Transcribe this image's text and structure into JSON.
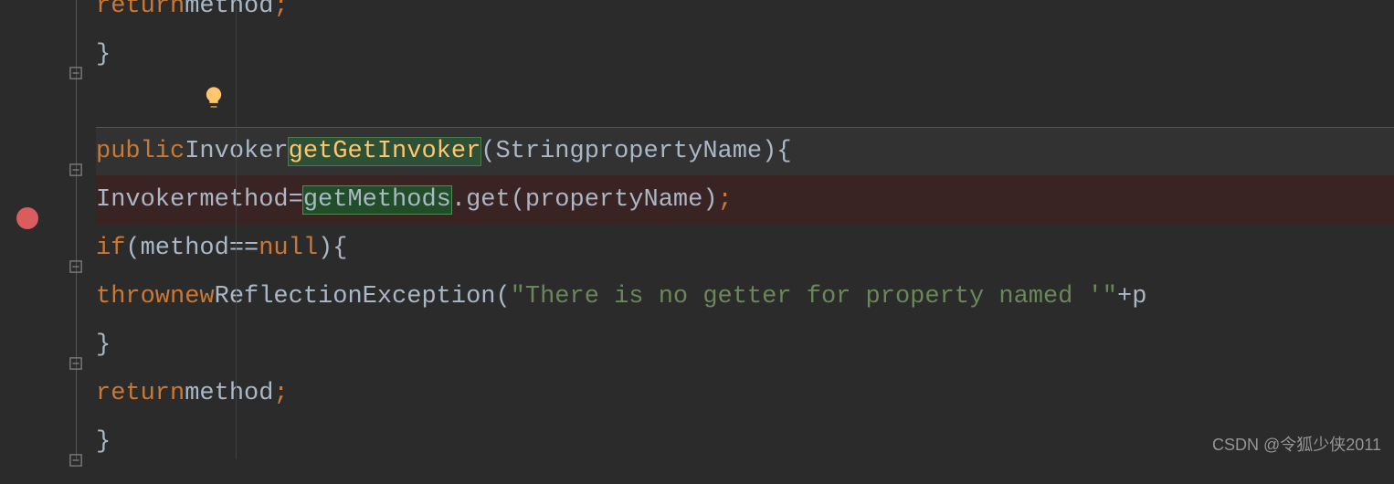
{
  "code": {
    "line0": {
      "return": "return",
      "method": "method",
      "semi": ";"
    },
    "line1": {
      "brace": "}"
    },
    "line3": {
      "public": "public",
      "type": "Invoker",
      "name": "getGetInvoker",
      "params_open": "(",
      "param_type": "String",
      "param_name": "propertyName",
      "params_close": ")",
      "brace": "{"
    },
    "line4": {
      "type": "Invoker",
      "varname": "method",
      "eq": "=",
      "call1": "getMethods",
      "dot": ".",
      "call2": "get",
      "open": "(",
      "arg": "propertyName",
      "close": ")",
      "semi": ";"
    },
    "line5": {
      "if": "if",
      "open": "(",
      "var": "method",
      "eqeq": "==",
      "null": "null",
      "close": ")",
      "brace": "{"
    },
    "line6": {
      "throw": "throw",
      "new": "new",
      "exc": "ReflectionException",
      "open": "(",
      "str": "\"There is no getter for property named '\"",
      "plus": "+",
      "tail": "p"
    },
    "line7": {
      "brace": "}"
    },
    "line8": {
      "return": "return",
      "method": "method",
      "semi": ";"
    },
    "line9": {
      "brace": "}"
    }
  },
  "icons": {
    "fold_minus": "minus-square-icon",
    "fold_up": "fold-up-icon",
    "breakpoint": "breakpoint-icon",
    "bulb": "lightbulb-icon"
  },
  "watermark": "CSDN @令狐少侠2011"
}
